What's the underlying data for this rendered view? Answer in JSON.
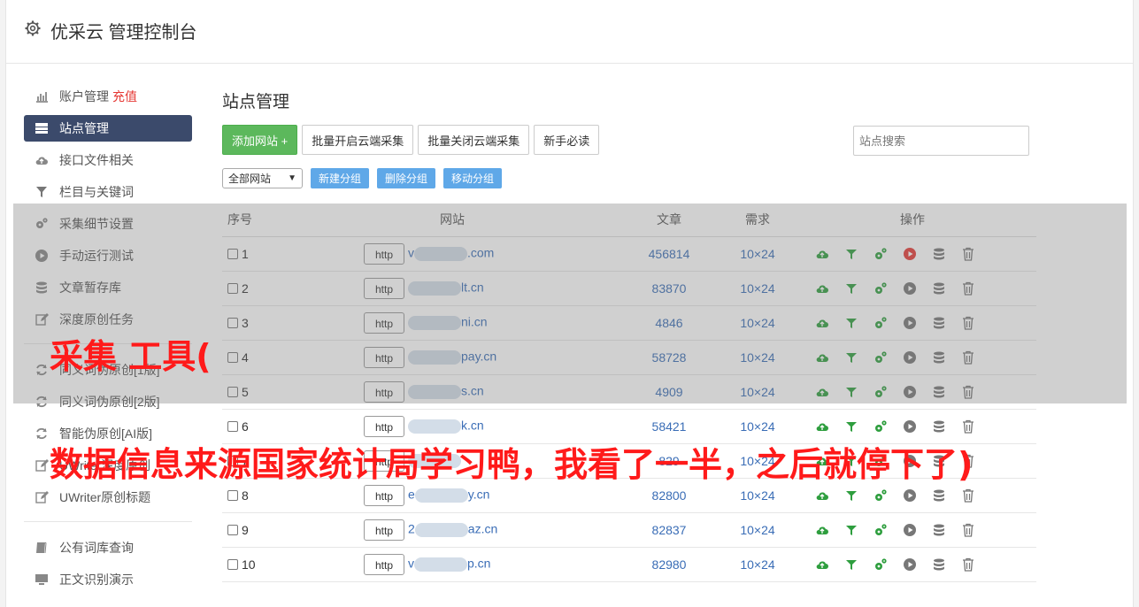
{
  "header": {
    "title": "优采云 管理控制台"
  },
  "sidebar": {
    "items": [
      {
        "label": "账户管理",
        "extra": "充值",
        "icon": "bar-chart-icon"
      },
      {
        "label": "站点管理",
        "icon": "server-icon",
        "active": true
      },
      {
        "label": "接口文件相关",
        "icon": "cloud-upload-icon"
      },
      {
        "label": "栏目与关键词",
        "icon": "filter-icon"
      },
      {
        "label": "采集细节设置",
        "icon": "cogs-icon"
      },
      {
        "label": "手动运行测试",
        "icon": "play-icon"
      },
      {
        "label": "文章暂存库",
        "icon": "database-icon"
      },
      {
        "label": "深度原创任务",
        "icon": "edit-icon"
      },
      {
        "label": "同义词伪原创[1版]",
        "icon": "refresh-icon"
      },
      {
        "label": "同义词伪原创[2版]",
        "icon": "refresh-icon"
      },
      {
        "label": "智能伪原创[AI版]",
        "icon": "refresh-icon"
      },
      {
        "label": "UWriter深度原创",
        "icon": "edit-icon"
      },
      {
        "label": "UWriter原创标题",
        "icon": "edit-icon"
      },
      {
        "label": "公有词库查询",
        "icon": "book-icon"
      },
      {
        "label": "正文识别演示",
        "icon": "monitor-icon"
      }
    ]
  },
  "main": {
    "title": "站点管理",
    "buttons": {
      "add_site": "添加网站 +",
      "batch_open": "批量开启云端采集",
      "batch_close": "批量关闭云端采集",
      "newbie": "新手必读"
    },
    "search_placeholder": "站点搜索",
    "group_select": "全部网站",
    "group_buttons": {
      "new": "新建分组",
      "delete": "删除分组",
      "move": "移动分组"
    },
    "table": {
      "headers": {
        "index": "序号",
        "site": "网站",
        "articles": "文章",
        "demand": "需求",
        "ops": "操作"
      },
      "http_label": "http",
      "rows": [
        {
          "index": "1",
          "site_prefix": "v",
          "site_suffix": ".com",
          "articles": "456814",
          "demand": "10×24",
          "running": true
        },
        {
          "index": "2",
          "site_prefix": "",
          "site_suffix": "lt.cn",
          "articles": "83870",
          "demand": "10×24",
          "running": false
        },
        {
          "index": "3",
          "site_prefix": "",
          "site_suffix": "ni.cn",
          "articles": "4846",
          "demand": "10×24",
          "running": false
        },
        {
          "index": "4",
          "site_prefix": "",
          "site_suffix": "pay.cn",
          "articles": "58728",
          "demand": "10×24",
          "running": false
        },
        {
          "index": "5",
          "site_prefix": "",
          "site_suffix": "s.cn",
          "articles": "4909",
          "demand": "10×24",
          "running": false
        },
        {
          "index": "6",
          "site_prefix": "",
          "site_suffix": "k.cn",
          "articles": "58421",
          "demand": "10×24",
          "running": false
        },
        {
          "index": "7",
          "site_prefix": "",
          "site_suffix": "",
          "articles": "829",
          "demand": "10×24",
          "running": false
        },
        {
          "index": "8",
          "site_prefix": "e",
          "site_suffix": "y.cn",
          "articles": "82800",
          "demand": "10×24",
          "running": false
        },
        {
          "index": "9",
          "site_prefix": "2",
          "site_suffix": "az.cn",
          "articles": "82837",
          "demand": "10×24",
          "running": false
        },
        {
          "index": "10",
          "site_prefix": "v",
          "site_suffix": "p.cn",
          "articles": "82980",
          "demand": "10×24",
          "running": false
        }
      ]
    }
  },
  "overlay_caption": {
    "line1": "采集 工具(",
    "line2": "数据信息来源国家统计局学习鸭，我看了一半，之后就停下了)"
  }
}
